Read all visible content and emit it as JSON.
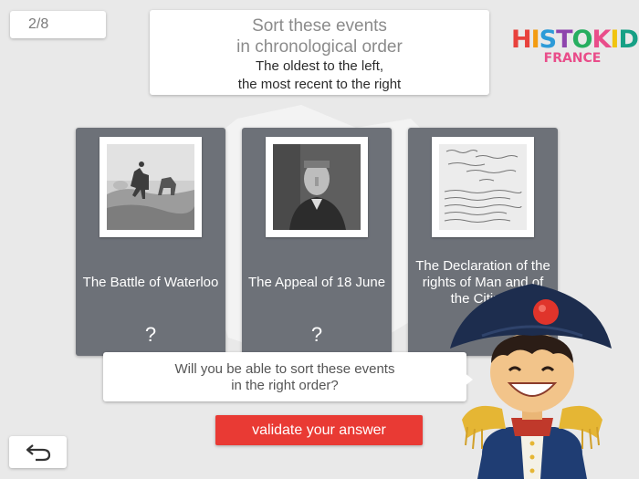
{
  "progress": {
    "text": "2/8"
  },
  "instructions": {
    "title_line1": "Sort these events",
    "title_line2": "in chronological order",
    "sub_line1": "The oldest to the left,",
    "sub_line2": "the most recent to the right"
  },
  "logo": {
    "letters": [
      "H",
      "I",
      "S",
      "T",
      "O",
      "K",
      "I",
      "D",
      "S"
    ],
    "letter_colors": [
      "#e8413c",
      "#f39c12",
      "#2d9bd8",
      "#8e44ad",
      "#27ae60",
      "#e94d8a",
      "#f1c40f",
      "#16a085",
      "#e67e22"
    ],
    "country": "FRANCE"
  },
  "cards": [
    {
      "label": "The Battle of Waterloo",
      "answer": "?",
      "image": "battle-painting"
    },
    {
      "label": "The Appeal of 18 June",
      "answer": "?",
      "image": "portrait-photo"
    },
    {
      "label": "The Declaration of the rights of Man and of the Citizen",
      "answer": "",
      "image": "manuscript-document"
    }
  ],
  "bubble": {
    "line1": "Will you be able to sort these events",
    "line2": "in the right order?"
  },
  "validate_label": "validate your answer",
  "colors": {
    "card_bg": "#6d7178",
    "validate_bg": "#e93a34",
    "page_bg": "#e9e9e9"
  }
}
